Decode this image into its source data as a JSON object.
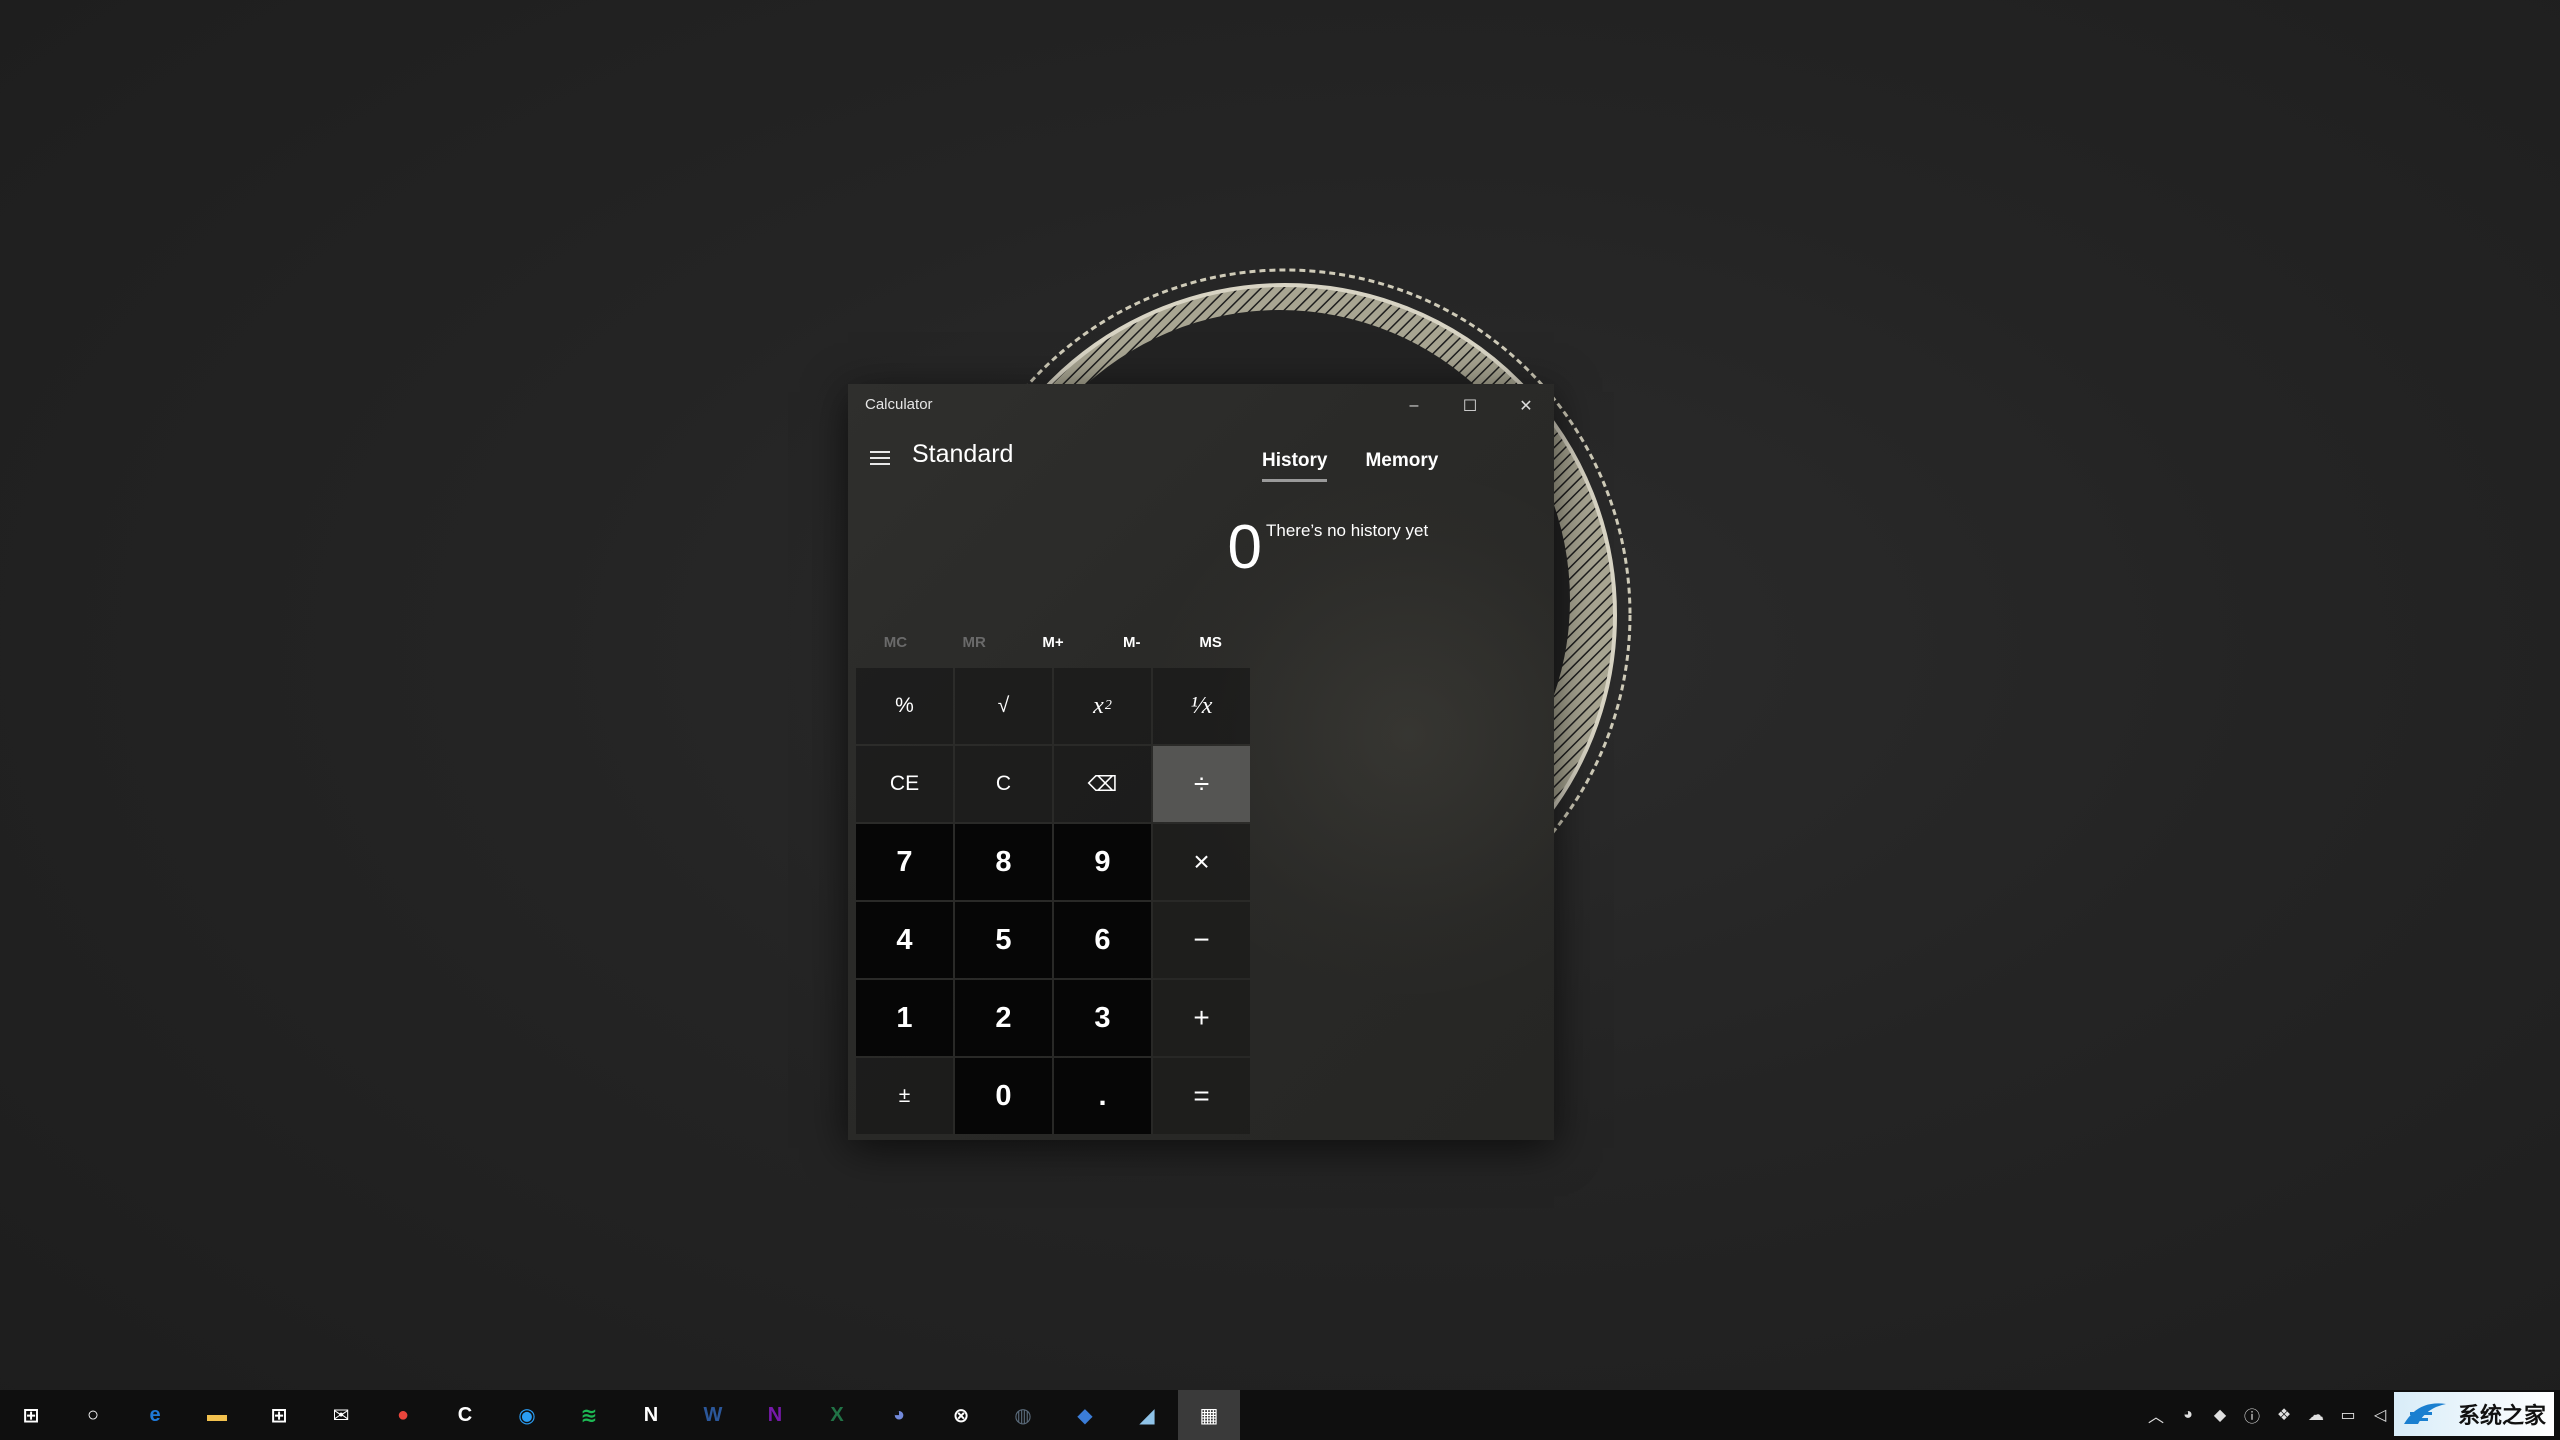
{
  "window": {
    "title": "Calculator",
    "minimize_glyph": "–",
    "maximize_glyph": "☐",
    "close_glyph": "✕"
  },
  "header": {
    "mode": "Standard",
    "tabs": [
      {
        "label": "History",
        "active": true
      },
      {
        "label": "Memory",
        "active": false
      }
    ]
  },
  "display": {
    "value": "0"
  },
  "history": {
    "empty_message": "There’s no history yet"
  },
  "memory_buttons": [
    {
      "label": "MC",
      "enabled": false
    },
    {
      "label": "MR",
      "enabled": false
    },
    {
      "label": "M+",
      "enabled": true
    },
    {
      "label": "M-",
      "enabled": true
    },
    {
      "label": "MS",
      "enabled": true
    }
  ],
  "keys": [
    {
      "label": "%",
      "type": "fn"
    },
    {
      "label": "√",
      "type": "fn"
    },
    {
      "label": "x",
      "sup": "2",
      "type": "fn"
    },
    {
      "label": "¹⁄x",
      "type": "fn"
    },
    {
      "label": "CE",
      "type": "fn"
    },
    {
      "label": "C",
      "type": "fn"
    },
    {
      "label": "⌫",
      "type": "fn"
    },
    {
      "label": "÷",
      "type": "op",
      "hover": true
    },
    {
      "label": "7",
      "type": "num"
    },
    {
      "label": "8",
      "type": "num"
    },
    {
      "label": "9",
      "type": "num"
    },
    {
      "label": "×",
      "type": "op"
    },
    {
      "label": "4",
      "type": "num"
    },
    {
      "label": "5",
      "type": "num"
    },
    {
      "label": "6",
      "type": "num"
    },
    {
      "label": "−",
      "type": "op"
    },
    {
      "label": "1",
      "type": "num"
    },
    {
      "label": "2",
      "type": "num"
    },
    {
      "label": "3",
      "type": "num"
    },
    {
      "label": "+",
      "type": "op"
    },
    {
      "label": "±",
      "type": "fn"
    },
    {
      "label": "0",
      "type": "num"
    },
    {
      "label": ".",
      "type": "num"
    },
    {
      "label": "=",
      "type": "op"
    }
  ],
  "taskbar": {
    "apps": [
      {
        "name": "start-button",
        "icon": "windows-logo-icon",
        "glyph": "⊞",
        "color": "#ffffff"
      },
      {
        "name": "cortana-button",
        "icon": "cortana-circle-icon",
        "glyph": "○",
        "color": "#ffffff"
      },
      {
        "name": "taskbar-edge",
        "icon": "edge-icon",
        "glyph": "e",
        "color": "#1e78d7"
      },
      {
        "name": "taskbar-file-explorer",
        "icon": "folder-icon",
        "glyph": "▬",
        "color": "#f2c14e"
      },
      {
        "name": "taskbar-store",
        "icon": "store-bag-icon",
        "glyph": "⊞",
        "color": "#ffffff"
      },
      {
        "name": "taskbar-mail",
        "icon": "mail-icon",
        "glyph": "✉",
        "color": "#ffffff"
      },
      {
        "name": "taskbar-chrome",
        "icon": "chrome-icon",
        "glyph": "●",
        "color": "#e8453c"
      },
      {
        "name": "taskbar-ccleaner",
        "icon": "c-logo-icon",
        "glyph": "C",
        "color": "#ffffff"
      },
      {
        "name": "taskbar-browser",
        "icon": "browser-icon",
        "glyph": "◉",
        "color": "#2a9df4"
      },
      {
        "name": "taskbar-spotify",
        "icon": "spotify-icon",
        "glyph": "≋",
        "color": "#1db954"
      },
      {
        "name": "taskbar-notion",
        "icon": "n-logo-icon",
        "glyph": "N",
        "color": "#ffffff"
      },
      {
        "name": "taskbar-word",
        "icon": "word-icon",
        "glyph": "W",
        "color": "#2b579a"
      },
      {
        "name": "taskbar-onenote",
        "icon": "onenote-icon",
        "glyph": "N",
        "color": "#7719aa"
      },
      {
        "name": "taskbar-excel",
        "icon": "excel-icon",
        "glyph": "X",
        "color": "#217346"
      },
      {
        "name": "taskbar-discord",
        "icon": "discord-icon",
        "glyph": "◕",
        "color": "#7289da"
      },
      {
        "name": "taskbar-xbox",
        "icon": "xbox-icon",
        "glyph": "⊗",
        "color": "#ffffff"
      },
      {
        "name": "taskbar-app-round",
        "icon": "round-app-icon",
        "glyph": "◍",
        "color": "#5a6a7a"
      },
      {
        "name": "taskbar-app-blue",
        "icon": "blue-app-icon",
        "glyph": "◆",
        "color": "#3b7dd8"
      },
      {
        "name": "taskbar-app-pen",
        "icon": "pen-app-icon",
        "glyph": "◢",
        "color": "#8fc3e8"
      },
      {
        "name": "taskbar-calculator",
        "icon": "calculator-icon",
        "glyph": "▦",
        "color": "#ffffff",
        "active": true
      }
    ],
    "tray": [
      {
        "name": "tray-chevron",
        "icon": "chevron-up-icon",
        "glyph": "︿"
      },
      {
        "name": "tray-discord",
        "icon": "discord-tray-icon",
        "glyph": "◕"
      },
      {
        "name": "tray-app",
        "icon": "app-tray-icon",
        "glyph": "◆"
      },
      {
        "name": "tray-info",
        "icon": "info-icon",
        "glyph": "ⓘ"
      },
      {
        "name": "tray-dropbox",
        "icon": "dropbox-icon",
        "glyph": "❖"
      },
      {
        "name": "tray-onedrive",
        "icon": "cloud-icon",
        "glyph": "☁"
      },
      {
        "name": "tray-network",
        "icon": "network-icon",
        "glyph": "▭"
      },
      {
        "name": "tray-volume",
        "icon": "volume-icon",
        "glyph": "◁"
      }
    ],
    "watermark_text": "系统之家"
  }
}
